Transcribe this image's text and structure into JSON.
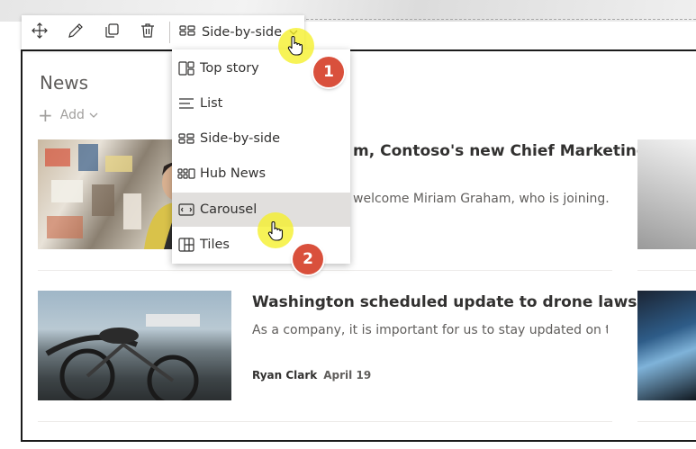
{
  "toolbar": {
    "tools": [
      "move-icon",
      "edit-icon",
      "duplicate-icon",
      "delete-icon"
    ],
    "layout_label": "Side-by-side"
  },
  "news": {
    "title": "News",
    "add_label": "Add",
    "stories": [
      {
        "title": "m, Contoso's new Chief Marketing",
        "description": "welcome Miriam Graham, who is joining..."
      },
      {
        "title": "Washington scheduled update to drone laws",
        "description": "As a company, it is important for us to stay updated on t...",
        "author": "Ryan Clark",
        "date": "April 19"
      }
    ]
  },
  "layout_menu": {
    "items": [
      {
        "label": "Top story",
        "icon": "top-story-icon"
      },
      {
        "label": "List",
        "icon": "list-icon"
      },
      {
        "label": "Side-by-side",
        "icon": "side-by-side-icon"
      },
      {
        "label": "Hub News",
        "icon": "hub-news-icon"
      },
      {
        "label": "Carousel",
        "icon": "carousel-icon"
      },
      {
        "label": "Tiles",
        "icon": "tiles-icon"
      }
    ],
    "hovered_index": 4
  },
  "callouts": [
    "1",
    "2"
  ],
  "colors": {
    "badge": "#d9503c",
    "highlight": "#f5f028",
    "hover": "#e1dfdd"
  }
}
